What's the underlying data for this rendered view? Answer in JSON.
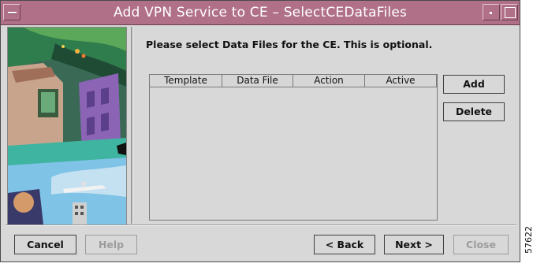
{
  "window": {
    "title": "Add VPN Service to CE – SelectCEDataFiles",
    "controls": {
      "menu_icon": "window-menu-icon",
      "minimize_icon": "minimize-icon",
      "maximize_icon": "maximize-icon"
    }
  },
  "instructions": "Please select Data Files for the CE. This is optional.",
  "table": {
    "columns": [
      "Template",
      "Data File",
      "Action",
      "Active"
    ],
    "rows": []
  },
  "side_buttons": {
    "add": "Add",
    "delete": "Delete"
  },
  "footer": {
    "cancel": "Cancel",
    "help": "Help",
    "back": "< Back",
    "next": "Next >",
    "close": "Close"
  },
  "figure_id": "57622",
  "colors": {
    "titlebar": "#b07088",
    "dialog": "#d8d8d8",
    "disabled_text": "#9c9c9c"
  }
}
